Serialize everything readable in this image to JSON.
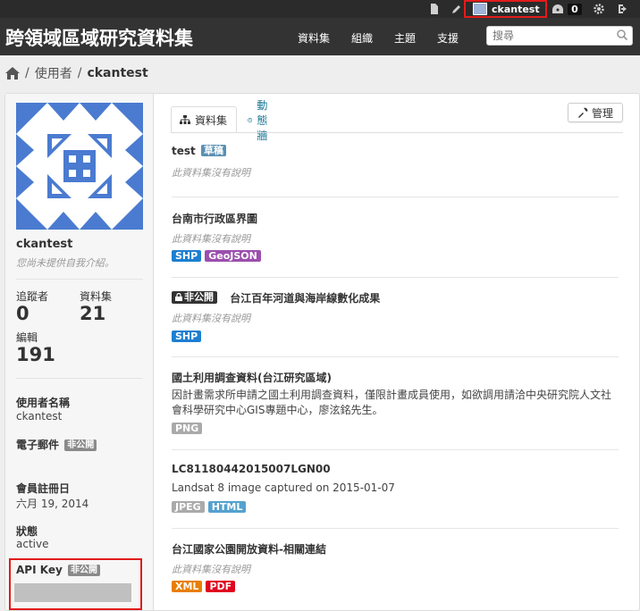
{
  "account": {
    "username": "ckantest",
    "activity_count": "0"
  },
  "site": {
    "title": "跨領域區域研究資料集",
    "nav": [
      "資料集",
      "組織",
      "主題",
      "支援"
    ],
    "search_placeholder": "搜尋"
  },
  "breadcrumb": {
    "users": "使用者",
    "current": "ckantest"
  },
  "sidebar": {
    "name": "ckantest",
    "about": "您尚未提供自我介紹。",
    "stats": {
      "followers_label": "追蹤者",
      "followers_value": "0",
      "datasets_label": "資料集",
      "datasets_value": "21",
      "edits_label": "編輯",
      "edits_value": "191"
    },
    "username_label": "使用者名稱",
    "username_value": "ckantest",
    "email_label": "電子郵件",
    "private_badge": "非公開",
    "member_since_label": "會員註冊日",
    "member_since_value": "六月 19, 2014",
    "state_label": "狀態",
    "state_value": "active",
    "api_key_label": "API Key"
  },
  "tabs": {
    "datasets": "資料集",
    "activity": "動態牆",
    "manage": "管理"
  },
  "datasets": [
    {
      "title": "test",
      "badge": "草稿",
      "notes": "此資料集沒有說明",
      "formats": []
    },
    {
      "title": "台南市行政區界圖",
      "notes": "此資料集沒有說明",
      "formats": [
        "SHP",
        "GeoJSON"
      ]
    },
    {
      "title": "台江百年河道與海岸線數化成果",
      "private_badge": "非公開",
      "notes": "此資料集沒有說明",
      "formats": [
        "SHP"
      ]
    },
    {
      "title": "國土利用調查資料(台江研究區域)",
      "notes": "因計畫需求所申請之國土利用調查資料，僅限計畫成員使用，如欲調用請洽中央研究院人文社會科學研究中心GIS專題中心，廖泫銘先生。",
      "formats": [
        "PNG"
      ]
    },
    {
      "title": "LC81180442015007LGN00",
      "notes": "Landsat 8 image captured on 2015-01-07",
      "formats": [
        "JPEG",
        "HTML"
      ]
    },
    {
      "title": "台江國家公園開放資料-相關連結",
      "notes": "此資料集沒有說明",
      "formats": [
        "XML",
        "PDF"
      ]
    }
  ],
  "colors": {
    "SHP": "#1d7fd1",
    "GeoJSON": "#9b4fae",
    "PNG": "#aaaaaa",
    "JPEG": "#aaaaaa",
    "HTML": "#55a1ce",
    "XML": "#e87e04",
    "PDF": "#e0051e",
    "highlight": "#e21b1b"
  }
}
